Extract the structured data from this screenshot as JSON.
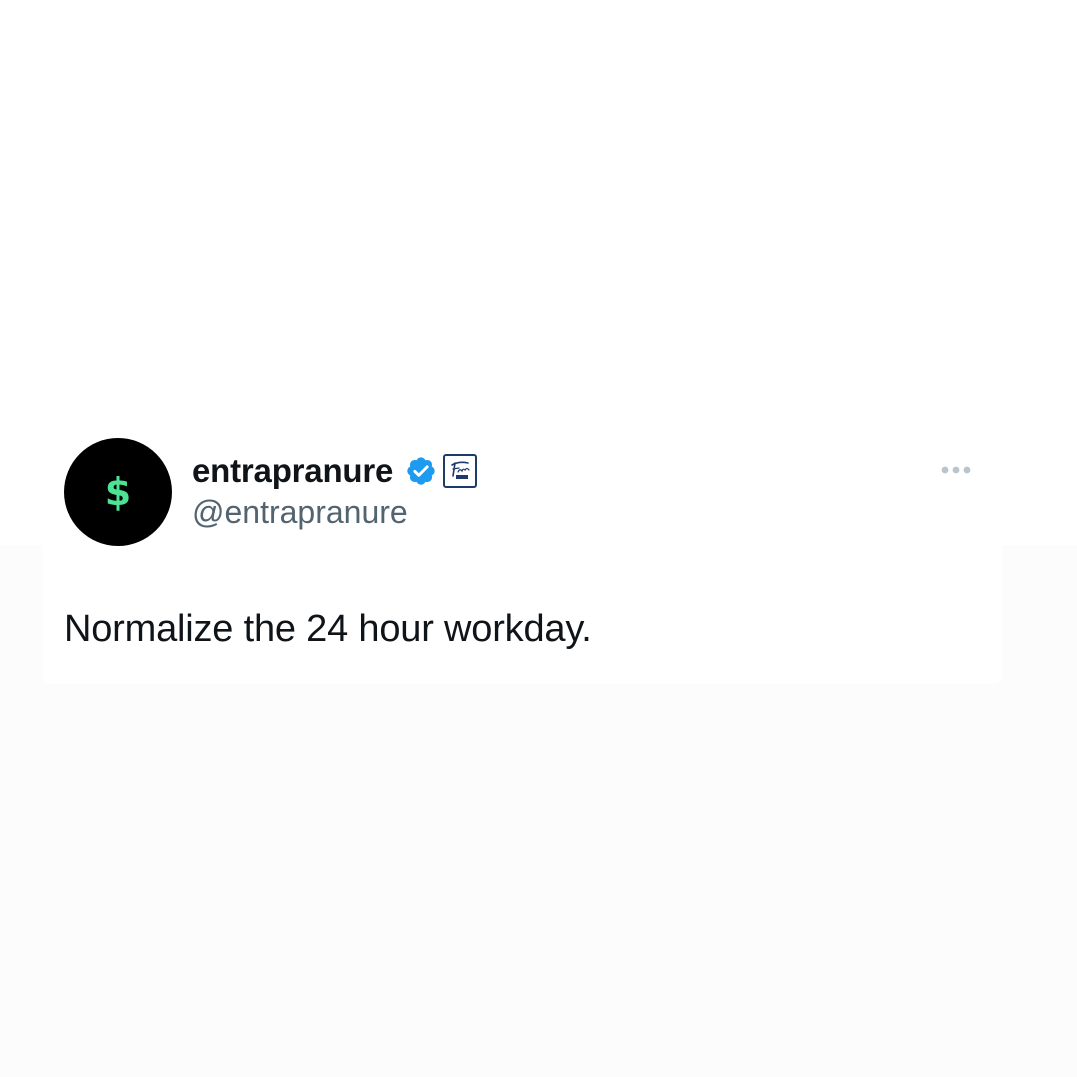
{
  "colors": {
    "verified_blue": "#1d9bf0",
    "avatar_background": "#000000",
    "dollar_green": "#4ee394",
    "name_text": "#0f1419",
    "handle_text": "#536471",
    "affiliate_badge_border": "#1d3a6b",
    "more_dots": "#b9c4cd"
  },
  "tweet": {
    "avatar": {
      "symbol": "$",
      "icon": "dollar-sign-icon"
    },
    "author": {
      "display_name": "entrapranure",
      "handle": "@entrapranure",
      "verified_icon": "verified-badge-icon",
      "affiliate_badge_icon": "friday-logo-badge-icon"
    },
    "more_icon": "more-horizontal-icon",
    "text": "Normalize the 24 hour workday."
  }
}
